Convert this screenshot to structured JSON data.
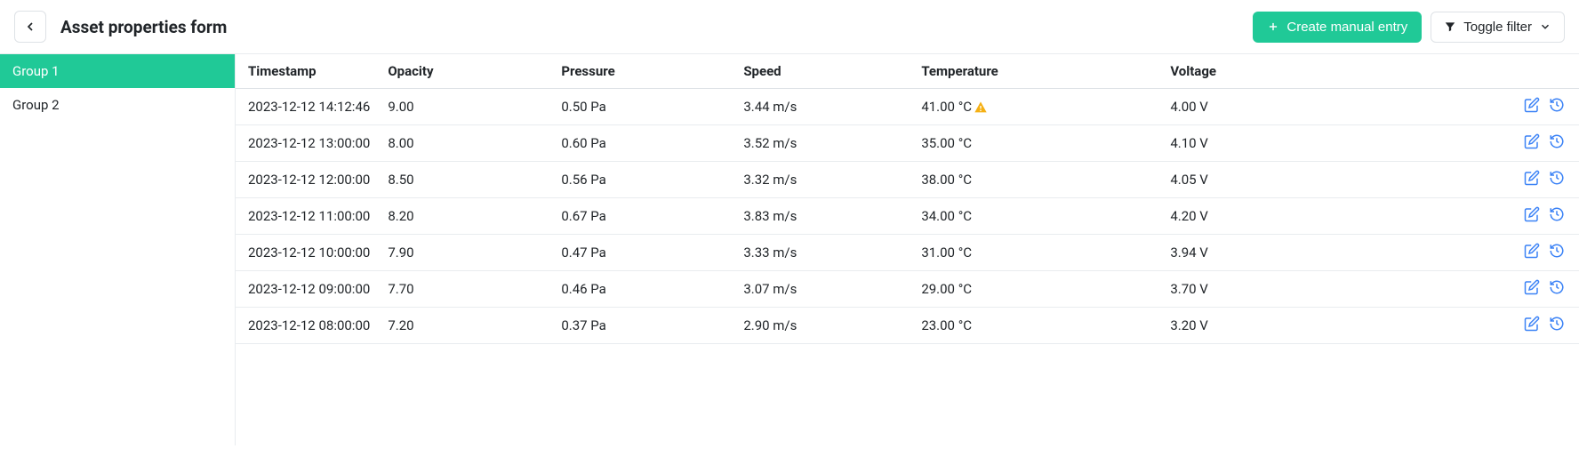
{
  "header": {
    "title": "Asset properties form",
    "create_button": "Create manual entry",
    "toggle_filter": "Toggle filter"
  },
  "sidebar": {
    "items": [
      {
        "label": "Group 1",
        "active": true
      },
      {
        "label": "Group 2",
        "active": false
      }
    ]
  },
  "table": {
    "columns": {
      "timestamp": "Timestamp",
      "opacity": "Opacity",
      "pressure": "Pressure",
      "speed": "Speed",
      "temperature": "Temperature",
      "voltage": "Voltage"
    },
    "rows": [
      {
        "timestamp": "2023-12-12 14:12:46",
        "opacity": "9.00",
        "pressure": "0.50 Pa",
        "speed": "3.44 m/s",
        "temperature": "41.00 °C",
        "temperature_warning": true,
        "voltage": "4.00 V"
      },
      {
        "timestamp": "2023-12-12 13:00:00",
        "opacity": "8.00",
        "pressure": "0.60 Pa",
        "speed": "3.52 m/s",
        "temperature": "35.00 °C",
        "temperature_warning": false,
        "voltage": "4.10 V"
      },
      {
        "timestamp": "2023-12-12 12:00:00",
        "opacity": "8.50",
        "pressure": "0.56 Pa",
        "speed": "3.32 m/s",
        "temperature": "38.00 °C",
        "temperature_warning": false,
        "voltage": "4.05 V"
      },
      {
        "timestamp": "2023-12-12 11:00:00",
        "opacity": "8.20",
        "pressure": "0.67 Pa",
        "speed": "3.83 m/s",
        "temperature": "34.00 °C",
        "temperature_warning": false,
        "voltage": "4.20 V"
      },
      {
        "timestamp": "2023-12-12 10:00:00",
        "opacity": "7.90",
        "pressure": "0.47 Pa",
        "speed": "3.33 m/s",
        "temperature": "31.00 °C",
        "temperature_warning": false,
        "voltage": "3.94 V"
      },
      {
        "timestamp": "2023-12-12 09:00:00",
        "opacity": "7.70",
        "pressure": "0.46 Pa",
        "speed": "3.07 m/s",
        "temperature": "29.00 °C",
        "temperature_warning": false,
        "voltage": "3.70 V"
      },
      {
        "timestamp": "2023-12-12 08:00:00",
        "opacity": "7.20",
        "pressure": "0.37 Pa",
        "speed": "2.90 m/s",
        "temperature": "23.00 °C",
        "temperature_warning": false,
        "voltage": "3.20 V"
      }
    ]
  }
}
